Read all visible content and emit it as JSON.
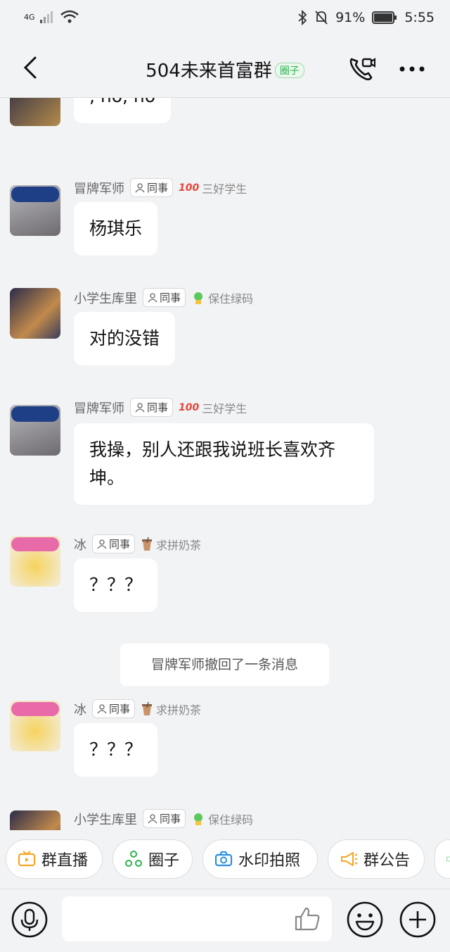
{
  "status_bar": {
    "network": "4G",
    "battery": "91%",
    "time": "5:55"
  },
  "header": {
    "title": "504未来首富群",
    "tag": "圈子"
  },
  "messages": [
    {
      "name": "",
      "badge": "",
      "honor": "",
      "text": ", no, no"
    },
    {
      "name": "冒牌军师",
      "badge": "同事",
      "honor": "三好学生",
      "text": "杨琪乐"
    },
    {
      "name": "小学生库里",
      "badge": "同事",
      "honor": "保住绿码",
      "text": "对的没错"
    },
    {
      "name": "冒牌军师",
      "badge": "同事",
      "honor": "三好学生",
      "text": "我操，别人还跟我说班长喜欢齐坤。"
    },
    {
      "name": "冰",
      "badge": "同事",
      "honor": "求拼奶茶",
      "text": "？？？"
    },
    {
      "name": "冰",
      "badge": "同事",
      "honor": "求拼奶茶",
      "text": "？？？"
    },
    {
      "name": "小学生库里",
      "badge": "同事",
      "honor": "保住绿码",
      "text": ""
    }
  ],
  "system_notice": "冒牌军师撤回了一条消息",
  "quick_actions": [
    "群直播",
    "圈子",
    "水印拍照",
    "群公告"
  ],
  "input": {
    "placeholder": ""
  },
  "colors": {
    "background": "#f2f3f5",
    "bubble": "#ffffff",
    "green_tag": "#2bb34b",
    "orange": "#f5a623"
  },
  "icons": [
    "back-icon",
    "video-call-icon",
    "more-icon",
    "coworker-icon",
    "voice-icon",
    "thumbs-up-icon",
    "emoji-icon",
    "plus-icon"
  ]
}
